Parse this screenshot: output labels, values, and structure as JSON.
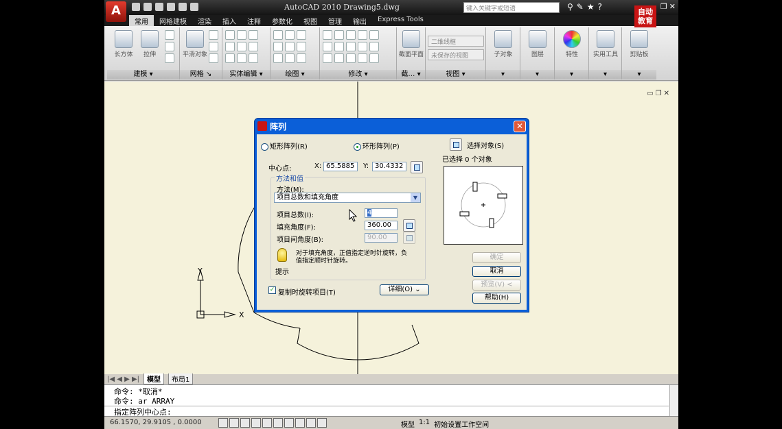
{
  "window": {
    "title": "AutoCAD 2010   Drawing5.dwg",
    "search_placeholder": "键入关键字或短语",
    "app_menu_label": "A"
  },
  "brand": {
    "line1": "自动",
    "line2": "教育"
  },
  "ribbon": {
    "tabs": [
      "常用",
      "网格建模",
      "渲染",
      "插入",
      "注释",
      "参数化",
      "视图",
      "管理",
      "输出",
      "Express Tools"
    ],
    "active_tab": "常用",
    "panels": [
      "建模 ▾",
      "网格 ↘",
      "实体编辑 ▾",
      "绘图 ▾",
      "修改 ▾",
      "截… ▾",
      "视图 ▾"
    ],
    "big_buttons": [
      "长方体",
      "拉伸",
      "平滑对象",
      "截面平面",
      "子对象",
      "图层",
      "特性",
      "实用工具",
      "剪贴板"
    ],
    "visual_style": "二维线框",
    "view_state": "未保存的视图"
  },
  "canvas": {
    "axis_x": "X",
    "axis_y": "Y"
  },
  "layout_tabs": [
    "模型",
    "布局1"
  ],
  "command": {
    "line1": "命令: *取消*",
    "line2": "命令: ar ARRAY",
    "prompt": "指定阵列中心点:"
  },
  "status": {
    "coords": "66.1570,  29.9105 , 0.0000",
    "model": "模型",
    "scale": "1:1",
    "workspace": "初始设置工作空间"
  },
  "dialog": {
    "title": "阵列",
    "radio_rect": "矩形阵列(R)",
    "radio_polar": "环形阵列(P)",
    "selected_mode": "polar",
    "select_objects": "选择对象(S)",
    "selected_count": "已选择 0 个对象",
    "center_label": "中心点:",
    "x_label": "X:",
    "x_value": "65.5885",
    "y_label": "Y:",
    "y_value": "30.4332",
    "group_title": "方法和值",
    "method_label": "方法(M):",
    "method_value": "项目总数和填充角度",
    "total_label": "项目总数(I):",
    "total_value": "4",
    "fill_label": "填充角度(F):",
    "fill_value": "360.00",
    "between_label": "项目间角度(B):",
    "between_value": "90.00",
    "hint_text_1": "对于填充角度，正值指定逆时针旋转，负",
    "hint_text_2": "值指定顺时针旋转。",
    "hint_label": "提示",
    "rotate_label": "复制时旋转项目(T)",
    "rotate_checked": "✓",
    "details_label": "详细(O)  ⌄",
    "ok_label": "确定",
    "cancel_label": "取消",
    "preview_label": "预览(V) <",
    "help_label": "帮助(H)"
  }
}
